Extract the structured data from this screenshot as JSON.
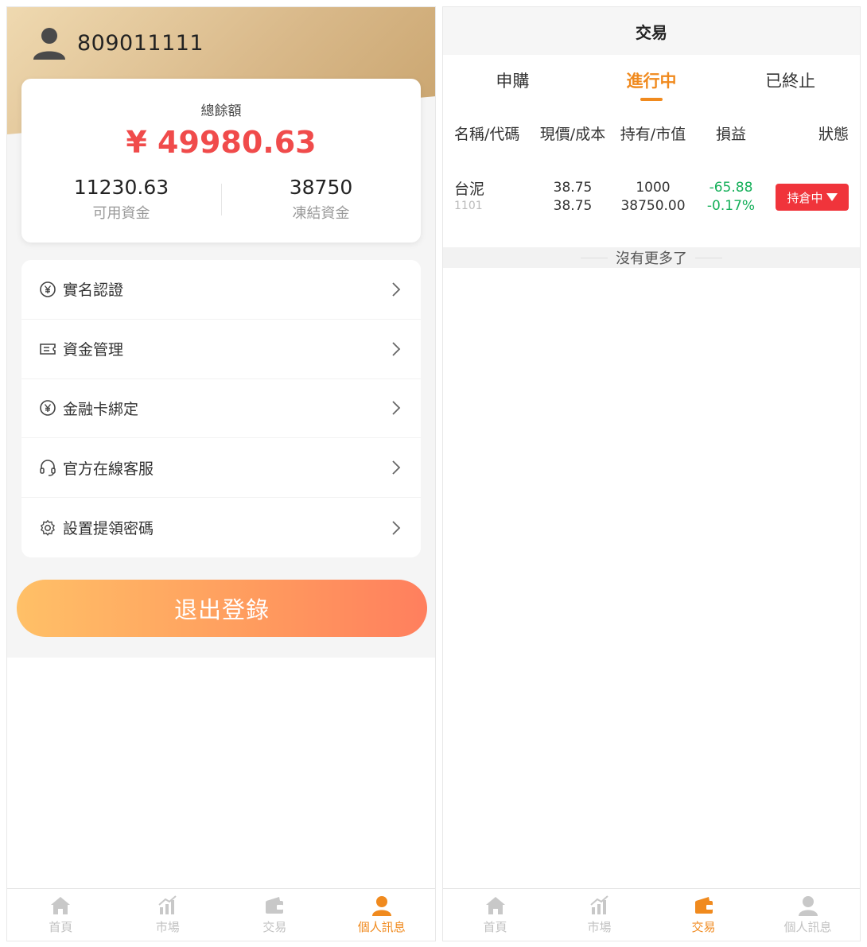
{
  "colors": {
    "accent": "#f08a1e",
    "negative_green": "#16b05a",
    "balance_red": "#f04b4b",
    "status_red": "#f0343b"
  },
  "profile": {
    "username": "809011111",
    "balance_label": "總餘額",
    "balance_amount": "¥ 49980.63",
    "available_amount": "11230.63",
    "available_label": "可用資金",
    "frozen_amount": "38750",
    "frozen_label": "凍結資金",
    "menu": [
      {
        "label": "實名認證",
        "icon": "yen-circle-icon"
      },
      {
        "label": "資金管理",
        "icon": "ticket-icon"
      },
      {
        "label": "金融卡綁定",
        "icon": "yen-circle-icon"
      },
      {
        "label": "官方在線客服",
        "icon": "headset-icon"
      },
      {
        "label": "設置提領密碼",
        "icon": "gear-icon"
      }
    ],
    "logout_label": "退出登錄"
  },
  "trade": {
    "title": "交易",
    "segments": [
      "申購",
      "進行中",
      "已終止"
    ],
    "active_segment": 1,
    "headers": [
      "名稱/代碼",
      "現價/成本",
      "持有/市值",
      "損益",
      "狀態"
    ],
    "rows": [
      {
        "name": "台泥",
        "code": "1101",
        "price": "38.75",
        "cost": "38.75",
        "hold": "1000",
        "value": "38750.00",
        "pnl": "-65.88",
        "pnl_pct": "-0.17%",
        "status": "持倉中"
      }
    ],
    "no_more": "沒有更多了"
  },
  "tabbar_left": [
    {
      "label": "首頁",
      "icon": "home-icon",
      "active": false
    },
    {
      "label": "市場",
      "icon": "chart-icon",
      "active": false
    },
    {
      "label": "交易",
      "icon": "wallet-icon",
      "active": false
    },
    {
      "label": "個人訊息",
      "icon": "user-icon",
      "active": true
    }
  ],
  "tabbar_right": [
    {
      "label": "首頁",
      "icon": "home-icon",
      "active": false
    },
    {
      "label": "市場",
      "icon": "chart-icon",
      "active": false
    },
    {
      "label": "交易",
      "icon": "wallet-icon",
      "active": true
    },
    {
      "label": "個人訊息",
      "icon": "user-icon",
      "active": false
    }
  ]
}
